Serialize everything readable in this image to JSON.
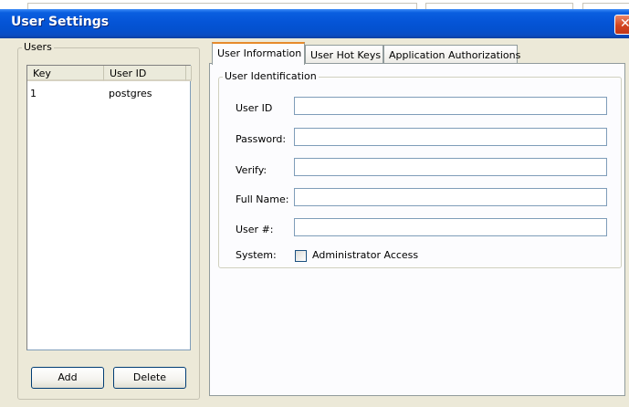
{
  "window": {
    "title": "User Settings",
    "close_glyph": "✕"
  },
  "users_group": {
    "legend": "Users",
    "columns": [
      "Key",
      "User ID"
    ],
    "rows": [
      {
        "key": "1",
        "user_id": "postgres"
      }
    ],
    "add_label": "Add",
    "delete_label": "Delete"
  },
  "tabs": [
    {
      "label": "User Information",
      "active": true
    },
    {
      "label": "User Hot Keys",
      "active": false
    },
    {
      "label": "Application Authorizations",
      "active": false
    }
  ],
  "identification": {
    "legend": "User Identification",
    "fields": [
      {
        "label": "User ID",
        "value": ""
      },
      {
        "label": "Password:",
        "value": ""
      },
      {
        "label": "Verify:",
        "value": ""
      },
      {
        "label": "Full Name:",
        "value": ""
      },
      {
        "label": "User #:",
        "value": ""
      }
    ],
    "system_label": "System:",
    "admin_checkbox_label": "Administrator Access",
    "admin_checked": false
  },
  "colors": {
    "titlebar": "#0554d6",
    "face": "#ECE9D8",
    "active_tab_accent": "#e68b2c"
  },
  "icons": {
    "close": "close-icon",
    "checkbox": "checkbox-icon"
  }
}
